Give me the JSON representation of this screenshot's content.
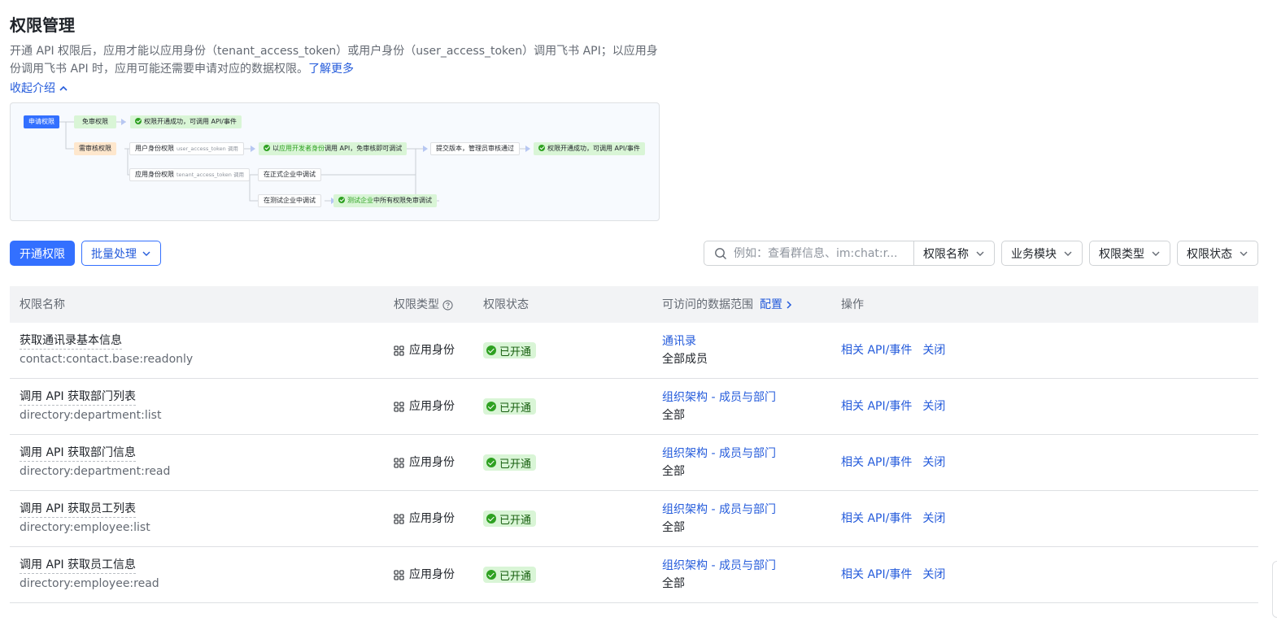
{
  "page": {
    "title": "权限管理",
    "intro_text": "开通 API 权限后，应用才能以应用身份（tenant_access_token）或用户身份（user_access_token）调用飞书 API；以应用身份调用飞书 API 时，应用可能还需要申请对应的数据权限。",
    "learn_more": "了解更多",
    "collapse_label": "收起介绍"
  },
  "flow": {
    "apply": "申请权限",
    "no_review": "免审权限",
    "no_review_result": "权限开通成功，可调用 API/事件",
    "need_review": "需审核权限",
    "user_perm": "用户身份权限",
    "user_token": "user_access_token 调用",
    "dev_debug_prefix": "以",
    "dev_debug_hl": "应用开发者身份",
    "dev_debug_suffix": "调用 API，免审核即可调试",
    "submit": "提交版本，管理员审核通过",
    "final_result": "权限开通成功，可调用 API/事件",
    "app_perm": "应用身份权限",
    "tenant_token": "tenant_access_token 调用",
    "prod_debug": "在正式企业中调试",
    "test_debug": "在测试企业中调试",
    "test_hl": "测试企业",
    "test_suffix": "中所有权限免审调试"
  },
  "toolbar": {
    "enable_button": "开通权限",
    "batch_button": "批量处理",
    "search_placeholder": "例如：查看群信息、im:chat:r...",
    "search_scope": "权限名称",
    "filters": [
      "业务模块",
      "权限类型",
      "权限状态"
    ]
  },
  "table": {
    "headers": {
      "name": "权限名称",
      "type": "权限类型",
      "status": "权限状态",
      "scope": "可访问的数据范围",
      "config": "配置",
      "ops": "操作"
    },
    "rows": [
      {
        "title": "获取通讯录基本信息",
        "key": "contact:contact.base:readonly",
        "type": "应用身份",
        "status": "已开通",
        "scope_link": "通讯录",
        "scope_value": "全部成员",
        "op_api": "相关 API/事件",
        "op_close": "关闭"
      },
      {
        "title": "调用 API 获取部门列表",
        "key": "directory:department:list",
        "type": "应用身份",
        "status": "已开通",
        "scope_link": "组织架构 - 成员与部门",
        "scope_value": "全部",
        "op_api": "相关 API/事件",
        "op_close": "关闭"
      },
      {
        "title": "调用 API 获取部门信息",
        "key": "directory:department:read",
        "type": "应用身份",
        "status": "已开通",
        "scope_link": "组织架构 - 成员与部门",
        "scope_value": "全部",
        "op_api": "相关 API/事件",
        "op_close": "关闭"
      },
      {
        "title": "调用 API 获取员工列表",
        "key": "directory:employee:list",
        "type": "应用身份",
        "status": "已开通",
        "scope_link": "组织架构 - 成员与部门",
        "scope_value": "全部",
        "op_api": "相关 API/事件",
        "op_close": "关闭"
      },
      {
        "title": "调用 API 获取员工信息",
        "key": "directory:employee:read",
        "type": "应用身份",
        "status": "已开通",
        "scope_link": "组织架构 - 成员与部门",
        "scope_value": "全部",
        "op_api": "相关 API/事件",
        "op_close": "关闭"
      }
    ]
  },
  "colors": {
    "primary": "#3370ff",
    "link": "#245bdb",
    "success": "#2ea121",
    "success_bg": "#d9f5d6",
    "header_bg": "#f2f3f5"
  }
}
